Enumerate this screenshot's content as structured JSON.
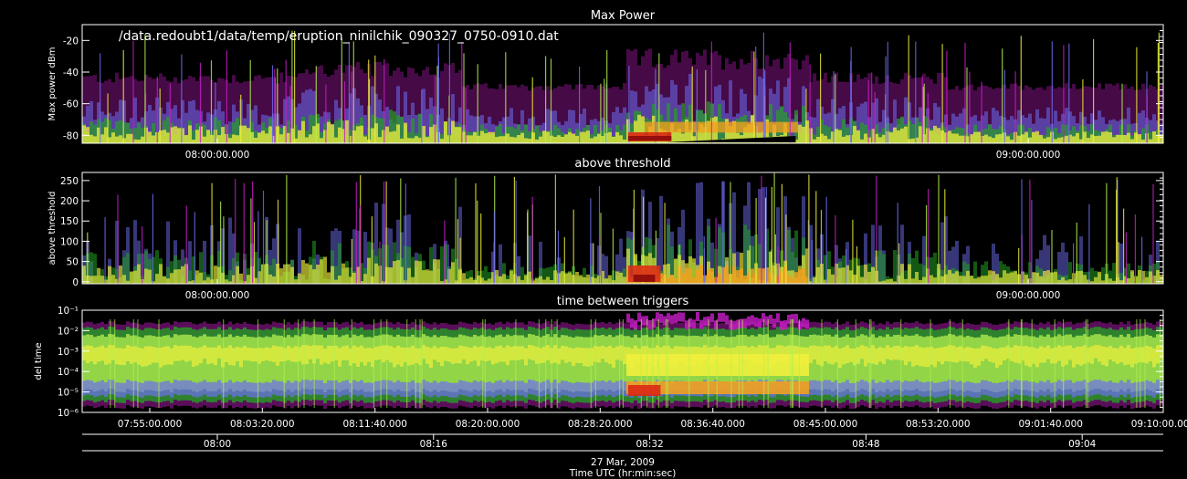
{
  "figure": {
    "file_path": "/data.redoubt1/data/temp/eruption_ninilchik_090327_0750-0910.dat",
    "date_label": "27 Mar, 2009",
    "xlabel": "Time UTC (hr:min:sec)"
  },
  "chart_data": [
    {
      "type": "heatmap",
      "title": "Max Power",
      "ylabel": "Max power dBm",
      "ylim": [
        -85,
        -10
      ],
      "yticks": [
        "-20",
        "-40",
        "-60",
        "-80"
      ],
      "x_tick_labels": [
        "08:00:00.000",
        "09:00:00.000"
      ],
      "x_tick_minutes": [
        10,
        70
      ],
      "xlim_minutes": [
        0,
        80
      ]
    },
    {
      "type": "heatmap",
      "title": "above threshold",
      "ylabel": "above threshold",
      "ylim": [
        -5,
        270
      ],
      "yticks": [
        "250",
        "200",
        "150",
        "100",
        "50",
        "0"
      ],
      "x_tick_labels": [
        "08:00:00.000",
        "09:00:00.000"
      ],
      "x_tick_minutes": [
        10,
        70
      ],
      "xlim_minutes": [
        0,
        80
      ]
    },
    {
      "type": "heatmap",
      "title": "time between triggers",
      "ylabel": "del time",
      "scale": "log",
      "ylim": [
        1e-06,
        0.1
      ],
      "yticks": [
        "10⁻¹",
        "10⁻²",
        "10⁻³",
        "10⁻⁴",
        "10⁻⁵",
        "10⁻⁶"
      ],
      "x_tick_labels": [
        "07:55:00.000",
        "08:03:20.000",
        "08:11:40.000",
        "08:20:00.000",
        "08:28:20.000",
        "08:36:40.000",
        "08:45:00.000",
        "08:53:20.000",
        "09:01:40.000",
        "09:10:00.000"
      ],
      "x_tick_minutes": [
        5,
        13.33,
        21.67,
        30,
        38.33,
        46.67,
        55,
        63.33,
        71.67,
        80
      ],
      "xlim_minutes": [
        0,
        80
      ]
    }
  ],
  "date_axis": {
    "tick_labels": [
      "08:00",
      "08:16",
      "08:32",
      "08:48",
      "09:04"
    ],
    "tick_minutes": [
      10,
      26,
      42,
      58,
      74
    ]
  },
  "colors": {
    "magenta": "#c81ec8",
    "blue": "#6e6ef0",
    "green": "#23a023",
    "lightgreen": "#b4f050",
    "yellow": "#f0f03c",
    "orange": "#f0a01e",
    "red": "#dc2814",
    "darkred": "#8c0a0a",
    "white": "#ffffff"
  }
}
